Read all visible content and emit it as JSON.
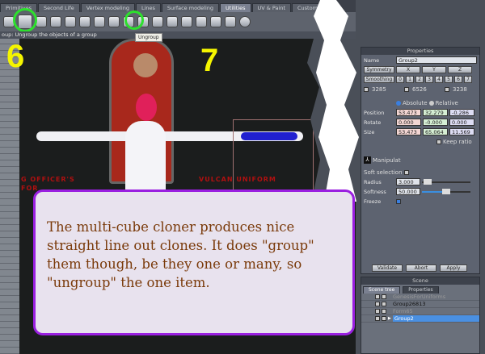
{
  "tabs": [
    "Primitives",
    "Second Life",
    "Vertex modeling",
    "Lines",
    "Surface modeling",
    "Utilities",
    "UV & Paint",
    "Custom"
  ],
  "active_tab": "Utilities",
  "status_text": "oup: Ungroup the objects of a group",
  "tooltip": "Ungroup",
  "viewport": {
    "numbers": [
      "6",
      "7"
    ],
    "labels": [
      "G OFFICER'S",
      "FOR",
      "VULCAN UNIFORM"
    ]
  },
  "properties": {
    "title": "Properties",
    "name_label": "Name",
    "name_value": "Group2",
    "symmetry": "Symmetry",
    "axes": [
      "X",
      "Y",
      "Z"
    ],
    "smoothing": "Smoothing",
    "smooth_levels": [
      "0",
      "1",
      "2",
      "3",
      "4",
      "5",
      "6",
      "7"
    ],
    "counts": [
      "3285",
      "6526",
      "3238"
    ],
    "absolute": "Absolute",
    "relative": "Relative",
    "rows": [
      {
        "label": "Position",
        "values": [
          "53.473",
          "32.279",
          "-0.286"
        ]
      },
      {
        "label": "Rotate",
        "values": [
          "0.000",
          "-0.000",
          "0.000"
        ]
      },
      {
        "label": "Size",
        "values": [
          "53.473",
          "65.064",
          "11.569"
        ]
      }
    ],
    "keep_ratio": "Keep ratio",
    "manipulator": "Manipulat",
    "soft_selection": "Soft selection",
    "radius_label": "Radius",
    "radius": "3.000",
    "softness_label": "Softness",
    "softness": "50.000",
    "freeze": "Freeze",
    "validate": "Validate",
    "abort": "Abort",
    "apply": "Apply"
  },
  "scene": {
    "title": "Scene",
    "tabs": [
      "Scene tree",
      "Properties"
    ],
    "items": [
      "GenesisForUniforms",
      "Group26813",
      "Form65",
      "Group2"
    ],
    "selected": "Group2"
  },
  "callout": "The multi-cube cloner produces nice straight line out clones. It does \"group\" them though, be they one or many, so \"ungroup\" the one item.",
  "colors": {
    "highlight": "#2de02d",
    "callout_border": "#9a1fe0",
    "callout_text": "#7a3a0a",
    "selection": "#4a90e2"
  }
}
